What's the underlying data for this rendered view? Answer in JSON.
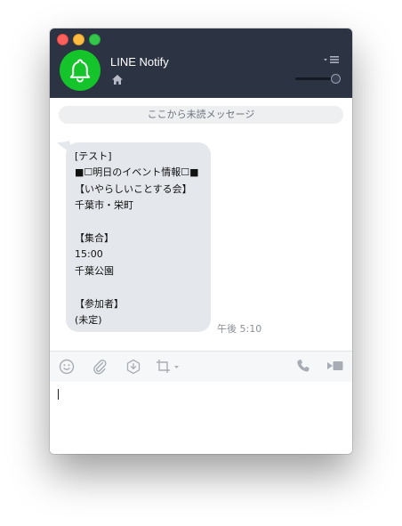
{
  "header": {
    "chat_name": "LINE Notify",
    "avatar_icon": "bell-icon",
    "avatar_color": "#14c42a",
    "header_color": "#2c3343"
  },
  "chat": {
    "unread_divider": "ここから未読メッセージ",
    "message": {
      "lines": [
        "[テスト]",
        "■☐明日のイベント情報☐■",
        "【いやらしいことする会】",
        "千葉市・栄町",
        "",
        "【集合】",
        "15:00",
        "千葉公園",
        "",
        "【参加者】",
        "(未定)"
      ],
      "time": "午後 5:10"
    }
  },
  "toolbar": {
    "icons": [
      "emoji-icon",
      "attachment-icon",
      "download-icon",
      "crop-icon",
      "phone-icon",
      "video-icon"
    ]
  }
}
